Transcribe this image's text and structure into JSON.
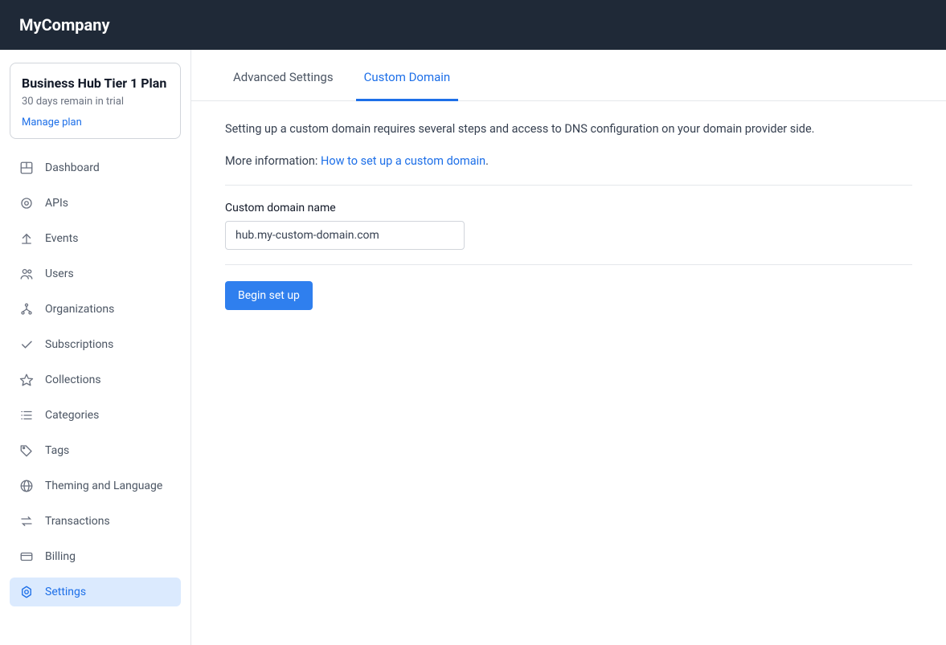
{
  "header": {
    "brand": "MyCompany"
  },
  "sidebar": {
    "plan": {
      "title": "Business Hub Tier 1 Plan",
      "subtitle": "30 days remain in trial",
      "manage_link": "Manage plan"
    },
    "items": [
      {
        "icon": "dashboard-icon",
        "label": "Dashboard"
      },
      {
        "icon": "apis-icon",
        "label": "APIs"
      },
      {
        "icon": "events-icon",
        "label": "Events"
      },
      {
        "icon": "users-icon",
        "label": "Users"
      },
      {
        "icon": "organizations-icon",
        "label": "Organizations"
      },
      {
        "icon": "subscriptions-icon",
        "label": "Subscriptions"
      },
      {
        "icon": "collections-icon",
        "label": "Collections"
      },
      {
        "icon": "categories-icon",
        "label": "Categories"
      },
      {
        "icon": "tags-icon",
        "label": "Tags"
      },
      {
        "icon": "globe-icon",
        "label": "Theming and Language"
      },
      {
        "icon": "transactions-icon",
        "label": "Transactions"
      },
      {
        "icon": "billing-icon",
        "label": "Billing"
      },
      {
        "icon": "settings-icon",
        "label": "Settings"
      }
    ],
    "active_index": 12
  },
  "main": {
    "tabs": [
      {
        "label": "Advanced Settings",
        "active": false
      },
      {
        "label": "Custom Domain",
        "active": true
      }
    ],
    "info_line_1": "Setting up a custom domain requires several steps and access to DNS configuration on your domain provider side.",
    "info_line_2_prefix": "More information: ",
    "info_line_2_link": "How to set up a custom domain",
    "info_line_2_suffix": ".",
    "form": {
      "domain_label": "Custom domain name",
      "domain_value": "hub.my-custom-domain.com",
      "submit_label": "Begin set up"
    }
  }
}
